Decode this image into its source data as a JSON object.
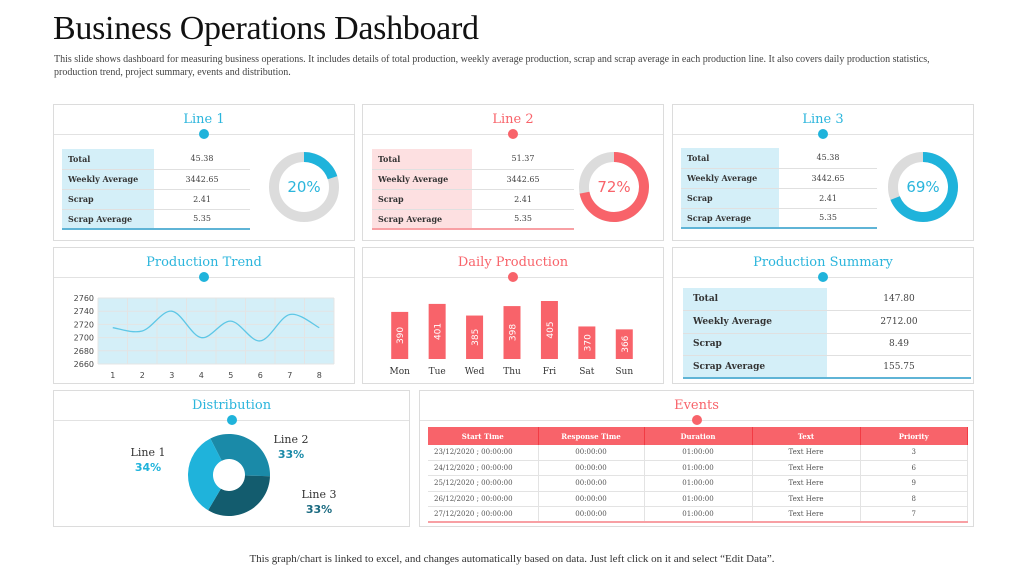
{
  "header": {
    "title": "Business Operations Dashboard",
    "subtitle": "This slide shows dashboard  for measuring  business operations.  It includes details of total production,  weekly average production,  scrap and scrap average  in each production  line. It also covers daily production  statistics, production  trend,  project  summary,  events and distribution."
  },
  "colors": {
    "blue": "#1fb3db",
    "red": "#f8636a",
    "gray": "#dcdcdc",
    "dark_teal": "#135c6e",
    "mid_teal": "#1a8aa8"
  },
  "lines": [
    {
      "title": "Line 1",
      "theme": "blue",
      "rows": [
        [
          "Total",
          "45.38"
        ],
        [
          "Weekly Average",
          "3442.65"
        ],
        [
          "Scrap",
          "2.41"
        ],
        [
          "Scrap Average",
          "5.35"
        ]
      ],
      "percent": 20,
      "percent_label": "20%"
    },
    {
      "title": "Line 2",
      "theme": "red",
      "rows": [
        [
          "Total",
          "51.37"
        ],
        [
          "Weekly Average",
          "3442.65"
        ],
        [
          "Scrap",
          "2.41"
        ],
        [
          "Scrap Average",
          "5.35"
        ]
      ],
      "percent": 72,
      "percent_label": "72%"
    },
    {
      "title": "Line 3",
      "theme": "blue",
      "rows": [
        [
          "Total",
          "45.38"
        ],
        [
          "Weekly Average",
          "3442.65"
        ],
        [
          "Scrap",
          "2.41"
        ],
        [
          "Scrap Average",
          "5.35"
        ]
      ],
      "percent": 69,
      "percent_label": "69%"
    }
  ],
  "summary": {
    "title": "Production Summary",
    "rows": [
      [
        "Total",
        "147.80"
      ],
      [
        "Weekly Average",
        "2712.00"
      ],
      [
        "Scrap",
        "8.49"
      ],
      [
        "Scrap Average",
        "155.75"
      ]
    ]
  },
  "events": {
    "title": "Events",
    "headers": [
      "Start Time",
      "Response Time",
      "Duration",
      "Text",
      "Priority"
    ],
    "rows": [
      [
        "23/12/2020  ;  00:00:00",
        "00:00:00",
        "01:00:00",
        "Text  Here",
        "3"
      ],
      [
        "24/12/2020  ;  00:00:00",
        "00:00:00",
        "01:00:00",
        "Text  Here",
        "6"
      ],
      [
        "25/12/2020  ;  00:00:00",
        "00:00:00",
        "01:00:00",
        "Text  Here",
        "9"
      ],
      [
        "26/12/2020  ;  00:00:00",
        "00:00:00",
        "01:00:00",
        "Text  Here",
        "8"
      ],
      [
        "27/12/2020  ;  00:00:00",
        "00:00:00",
        "01:00:00",
        "Text  Here",
        "7"
      ]
    ]
  },
  "footer": "This graph/chart is linked to excel, and changes automatically based on data. Just left click on it and select “Edit Data”.",
  "chart_data": [
    {
      "type": "line",
      "title": "Production Trend",
      "x": [
        1,
        2,
        3,
        4,
        5,
        6,
        7,
        8
      ],
      "values": [
        2715,
        2710,
        2740,
        2700,
        2725,
        2695,
        2735,
        2715
      ],
      "yticks": [
        2660,
        2680,
        2700,
        2720,
        2740,
        2760
      ],
      "ylim": [
        2660,
        2760
      ],
      "grid": true,
      "smooth": true
    },
    {
      "type": "bar",
      "title": "Daily Production",
      "categories": [
        "Mon",
        "Tue",
        "Wed",
        "Thu",
        "Fri",
        "Sat",
        "Sun"
      ],
      "values": [
        390,
        401,
        385,
        398,
        405,
        370,
        366
      ],
      "data_labels": true
    },
    {
      "type": "pie",
      "title": "Distribution",
      "donut": true,
      "labels": [
        "Line 1",
        "Line 2",
        "Line 3"
      ],
      "values": [
        34,
        33,
        33
      ],
      "value_labels": [
        "34%",
        "33%",
        "33%"
      ]
    }
  ]
}
